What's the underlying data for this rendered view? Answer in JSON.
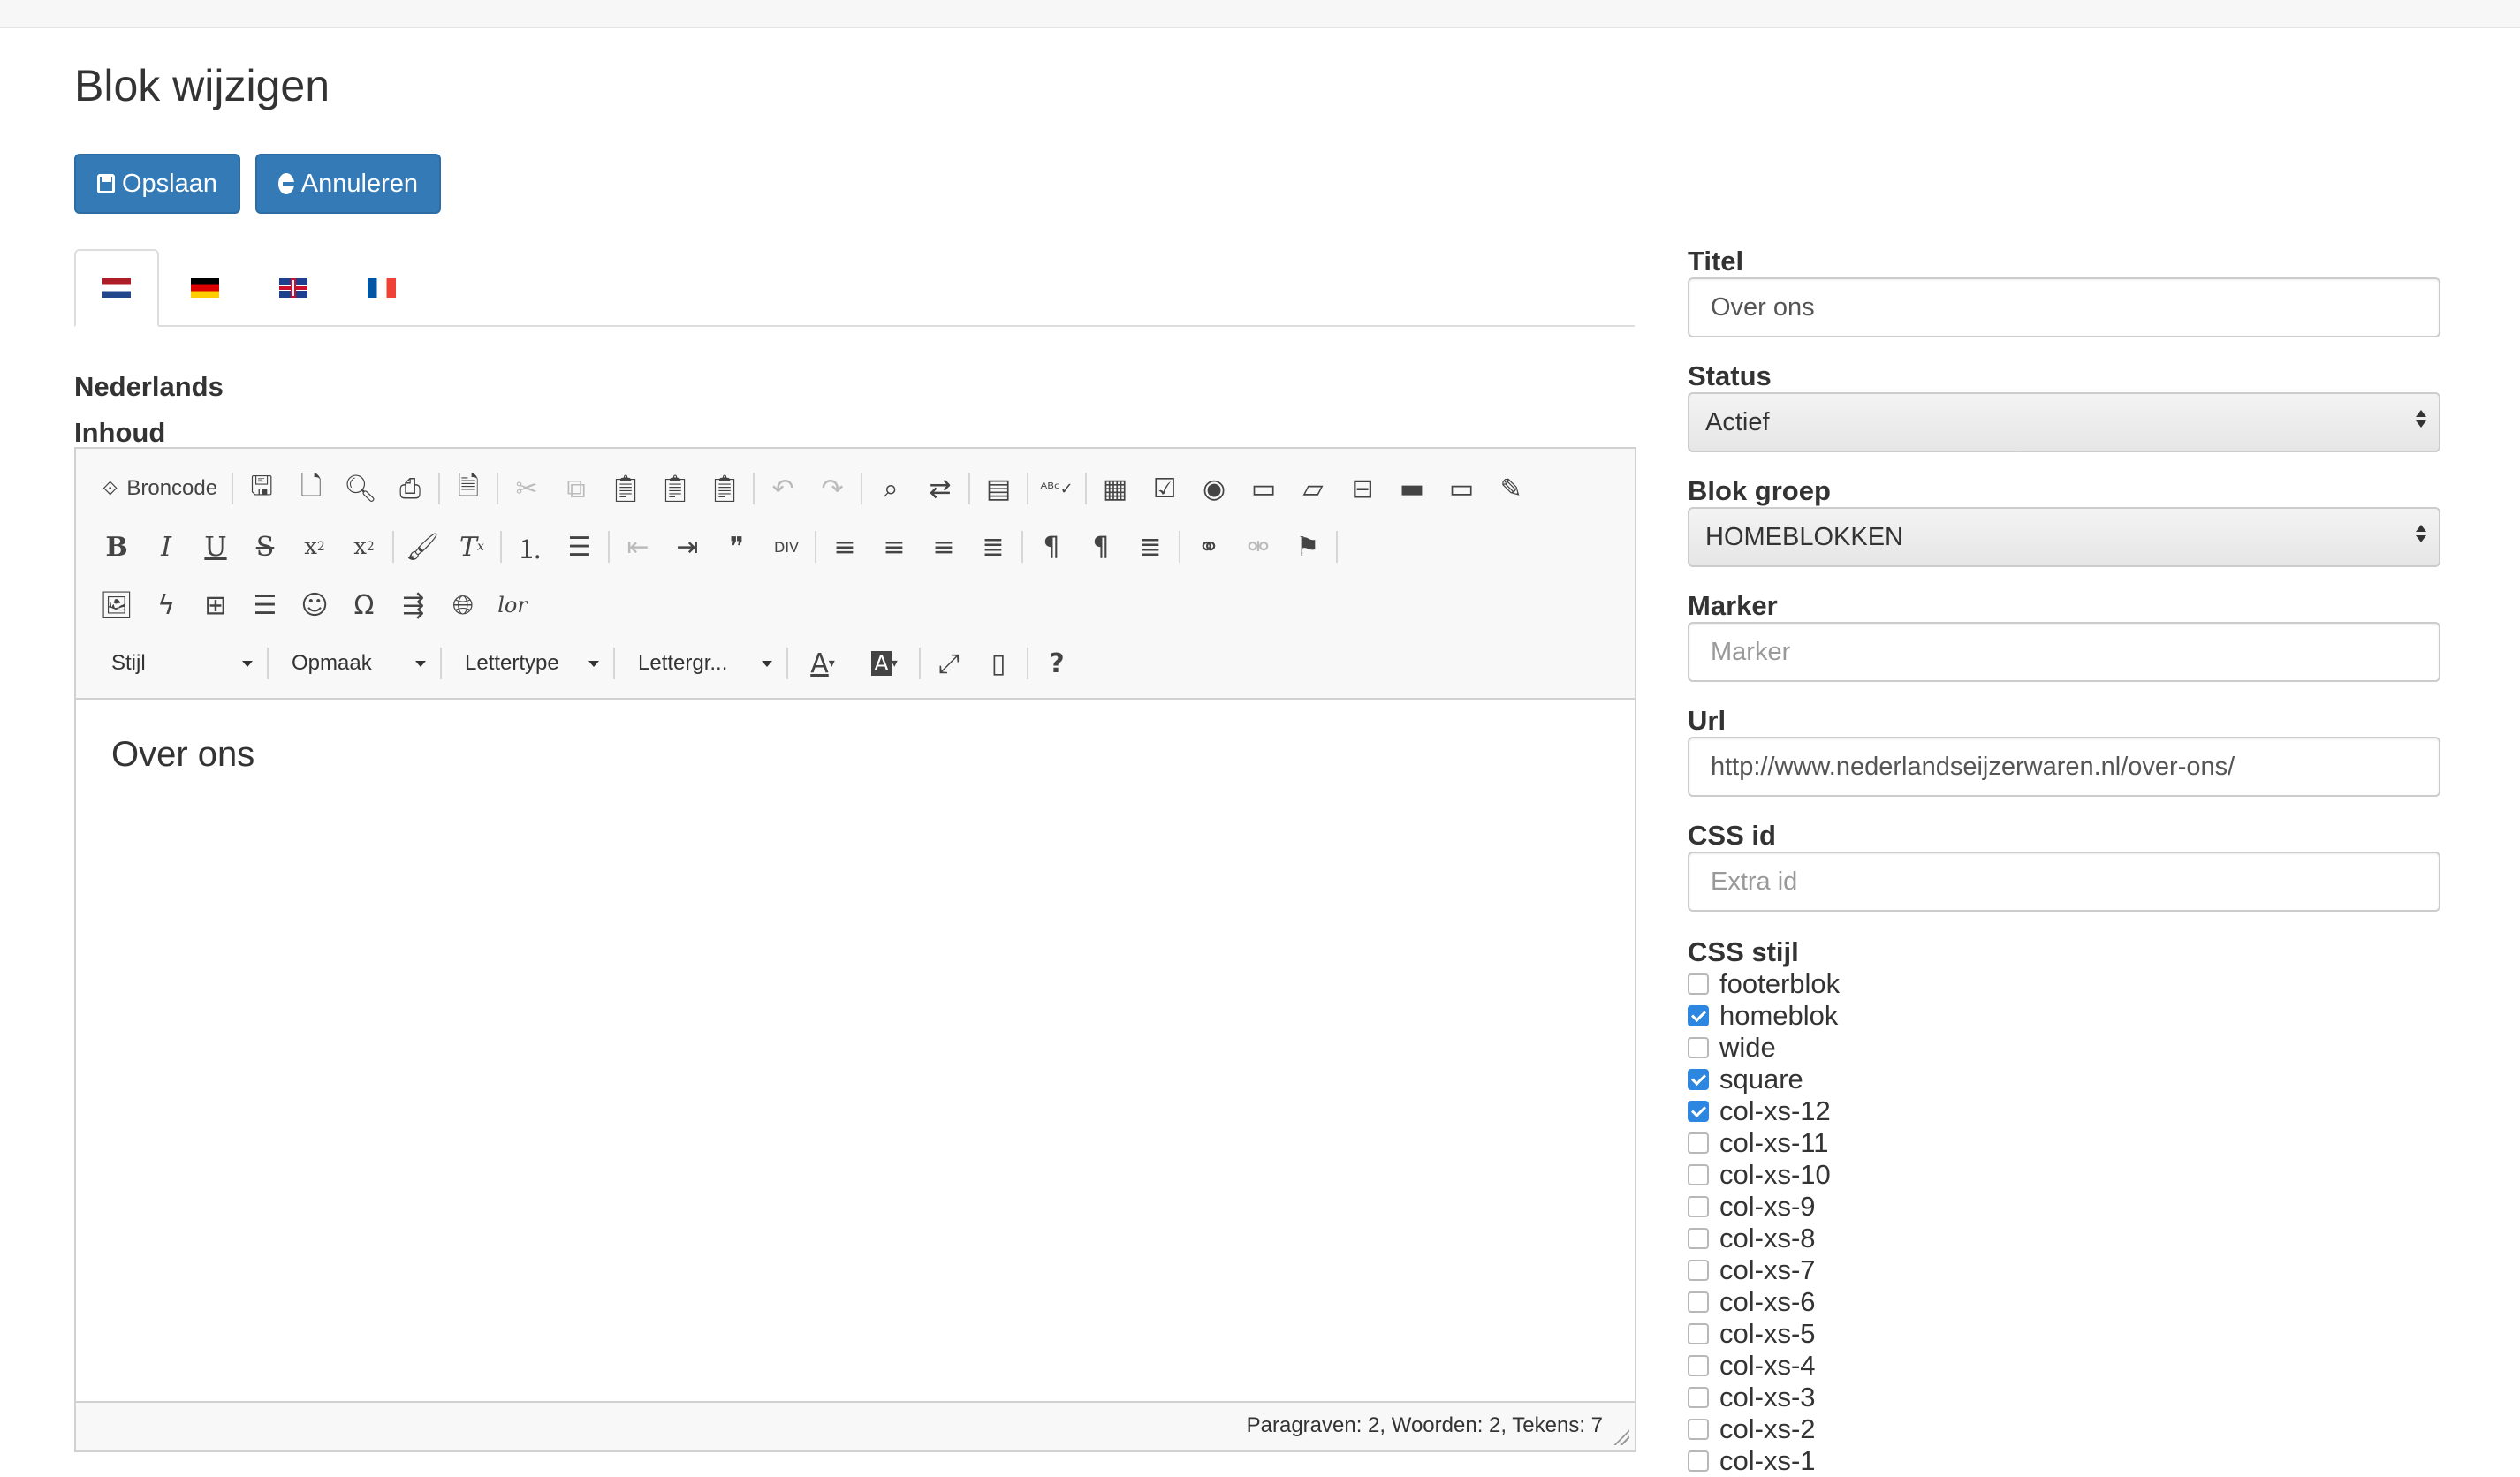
{
  "page_title": "Blok wijzigen",
  "buttons": {
    "save": "Opslaan",
    "cancel": "Annuleren"
  },
  "language_tabs": [
    {
      "code": "nl",
      "active": true
    },
    {
      "code": "de",
      "active": false
    },
    {
      "code": "gb",
      "active": false
    },
    {
      "code": "fr",
      "active": false
    }
  ],
  "language_label": "Nederlands",
  "content_label": "Inhoud",
  "editor": {
    "source_label": "Broncode",
    "combos": {
      "style": "Stijl",
      "format": "Opmaak",
      "font": "Lettertype",
      "size": "Lettergr..."
    },
    "content": "Over ons",
    "status": "Paragraven: 2, Woorden: 2, Tekens: 7"
  },
  "fields": {
    "titel": {
      "label": "Titel",
      "value": "Over ons"
    },
    "status": {
      "label": "Status",
      "value": "Actief"
    },
    "blok_groep": {
      "label": "Blok groep",
      "value": "HOMEBLOKKEN"
    },
    "marker": {
      "label": "Marker",
      "placeholder": "Marker"
    },
    "url": {
      "label": "Url",
      "value": "http://www.nederlandseijzerwaren.nl/over-ons/"
    },
    "css_id": {
      "label": "CSS id",
      "placeholder": "Extra id"
    },
    "css_stijl": {
      "label": "CSS stijl",
      "options": [
        {
          "label": "footerblok",
          "checked": false
        },
        {
          "label": "homeblok",
          "checked": true
        },
        {
          "label": "wide",
          "checked": false
        },
        {
          "label": "square",
          "checked": true
        },
        {
          "label": "col-xs-12",
          "checked": true
        },
        {
          "label": "col-xs-11",
          "checked": false
        },
        {
          "label": "col-xs-10",
          "checked": false
        },
        {
          "label": "col-xs-9",
          "checked": false
        },
        {
          "label": "col-xs-8",
          "checked": false
        },
        {
          "label": "col-xs-7",
          "checked": false
        },
        {
          "label": "col-xs-6",
          "checked": false
        },
        {
          "label": "col-xs-5",
          "checked": false
        },
        {
          "label": "col-xs-4",
          "checked": false
        },
        {
          "label": "col-xs-3",
          "checked": false
        },
        {
          "label": "col-xs-2",
          "checked": false
        },
        {
          "label": "col-xs-1",
          "checked": false
        }
      ]
    }
  },
  "colors": {
    "primary": "#337ab7",
    "checkbox_checked": "#2d86df"
  }
}
